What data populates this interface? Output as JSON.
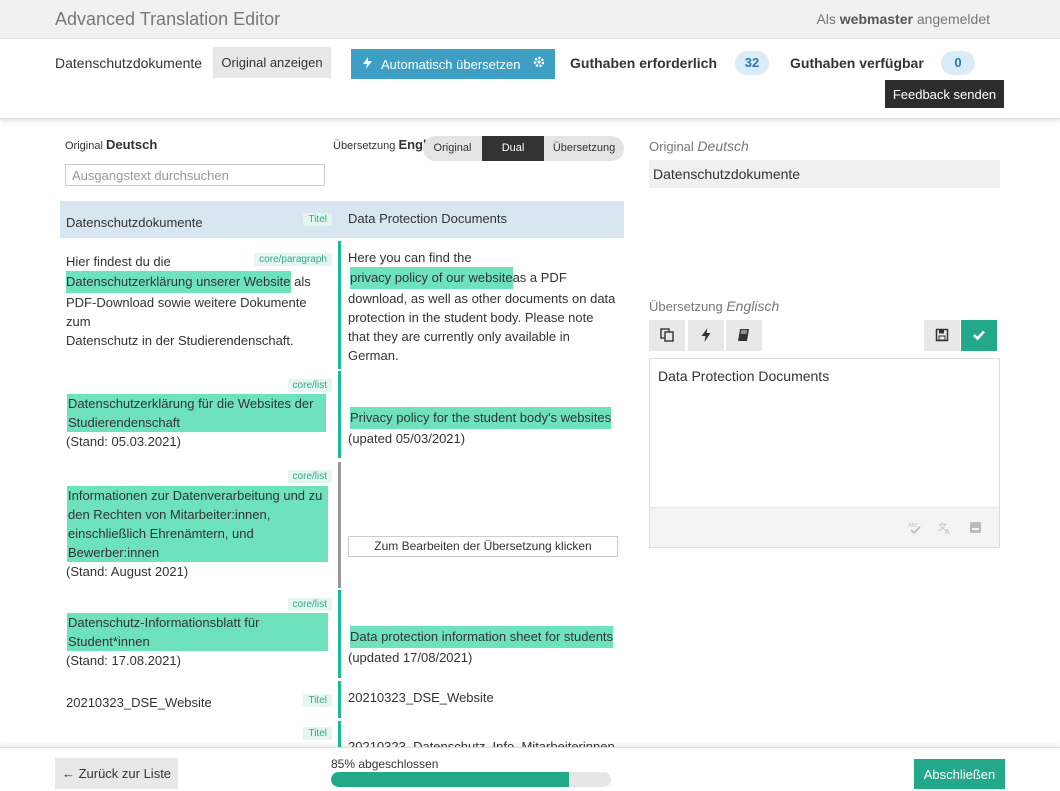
{
  "app": {
    "title": "Advanced Translation Editor",
    "login_prefix": "Als",
    "login_user": "webmaster",
    "login_suffix": "angemeldet"
  },
  "header": {
    "doc_name": "Datenschutzdokumente",
    "show_original_label": "Original anzeigen",
    "auto_translate_label": "Automatisch übersetzen",
    "credits_required_label": "Guthaben erforderlich",
    "credits_required_value": "32",
    "credits_available_label": "Guthaben verfügbar",
    "credits_available_value": "0",
    "feedback_label": "Feedback senden"
  },
  "columns": {
    "source_prefix": "Original",
    "source_lang": "Deutsch",
    "target_prefix": "Übersetzung",
    "target_lang": "Engl",
    "search_placeholder": "Ausgangstext durchsuchen"
  },
  "view_toggle": {
    "options": [
      "Original",
      "Dual",
      "Übersetzung"
    ],
    "active": "Dual"
  },
  "segments": [
    {
      "tag": "Titel",
      "source": "Datenschutzdokumente",
      "target": "Data Protection Documents"
    },
    {
      "tag": "core/paragraph",
      "source_pre": "Hier findest du die",
      "source_hl": "Datenschutzerklärung unserer Website",
      "source_post_1": "als",
      "source_post_2": "PDF-Download sowie weitere Dokumente zum",
      "source_post_3": "Datenschutz in der Studierendenschaft.",
      "target_pre": "Here you can find the",
      "target_hl": "privacy policy of our website",
      "target_post_1": "as a PDF",
      "target_post_2": "download, as well as other documents on data",
      "target_post_3": "protection in the student body. Please note",
      "target_post_4": "that they are currently only available in",
      "target_post_5": "German."
    },
    {
      "tag": "core/list",
      "source_hl_1": "Datenschutzerklärung für die Websites der",
      "source_hl_2": "Studierendenschaft",
      "source_post": "(Stand: 05.03.2021)",
      "target_hl": "Privacy policy for the student body's websites",
      "target_post": "(upated 05/03/2021)"
    },
    {
      "tag": "core/list",
      "source_hl_1": "Informationen zur Datenverarbeitung und zu",
      "source_hl_2": "den Rechten von Mitarbeiter:innen,",
      "source_hl_3": "einschließlich Ehrenämtern, und",
      "source_hl_4": "Bewerber:innen",
      "source_post": "(Stand: August 2021)",
      "target_placeholder": "Zum Bearbeiten der Übersetzung klicken"
    },
    {
      "tag": "core/list",
      "source_hl_1": "Datenschutz-Informationsblatt für",
      "source_hl_2": "Student*innen",
      "source_post": "(Stand: 17.08.2021)",
      "target_hl": "Data protection information sheet for students",
      "target_post": "(updated 17/08/2021)"
    },
    {
      "tag": "Titel",
      "source": "20210323_DSE_Website",
      "target": "20210323_DSE_Website"
    },
    {
      "tag": "Titel",
      "target": "20210323_Datenschutz_Info_Mitarbeiterinnen"
    }
  ],
  "editor": {
    "original_prefix": "Original",
    "original_lang": "Deutsch",
    "original_text": "Datenschutzdokumente",
    "translation_prefix": "Übersetzung",
    "translation_lang": "Englisch",
    "translation_text": "Data Protection Documents"
  },
  "footer": {
    "back_label": "← Zurück zur Liste",
    "progress_label": "85% abgeschlossen",
    "progress_percent": 85,
    "finish_label": "Abschließen"
  },
  "colors": {
    "accent_blue": "#3e9fc4",
    "accent_green": "#23a88a",
    "highlight": "#6ee2bd",
    "selected_row": "#d8e6f0"
  }
}
